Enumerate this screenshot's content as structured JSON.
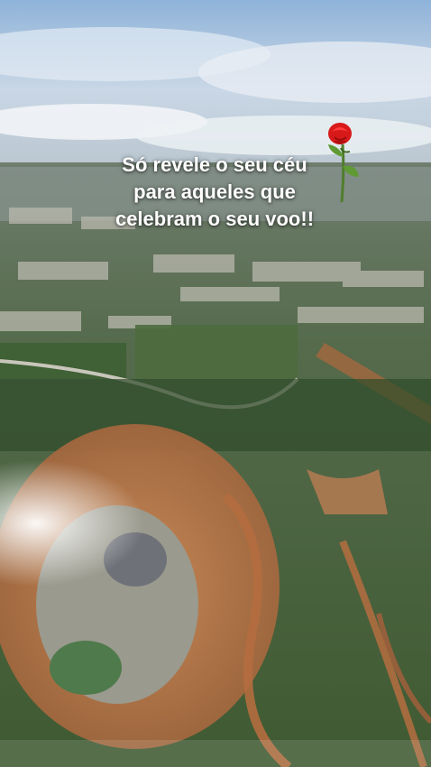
{
  "story": {
    "caption_lines": [
      "Só revele o seu céu",
      "para aqueles que",
      "celebram o seu voo!!"
    ],
    "sticker": "rose-emoji",
    "scene": "aerial-view-from-airplane-window"
  }
}
